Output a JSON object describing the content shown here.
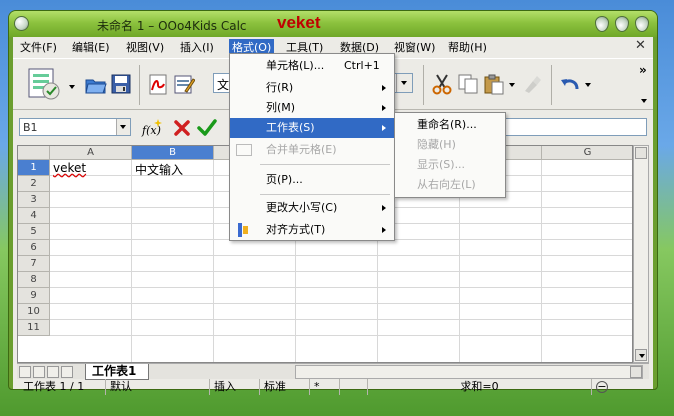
{
  "window": {
    "title": "未命名 1 – OOo4Kids Calc",
    "user": "veket"
  },
  "menubar": {
    "items": [
      "文件(F)",
      "编辑(E)",
      "视图(V)",
      "插入(I)",
      "格式(O)",
      "工具(T)",
      "数据(D)",
      "视窗(W)",
      "帮助(H)"
    ],
    "active": "格式(O)"
  },
  "toolbar": {
    "font_name": "文",
    "overflow": "»"
  },
  "formula": {
    "name_box": "B1",
    "function_icon": "f(x)"
  },
  "sheet": {
    "columns": [
      "A",
      "B",
      "C",
      "D",
      "E",
      "F",
      "G"
    ],
    "selected_column": "B",
    "rows": [
      "1",
      "2",
      "3",
      "4",
      "5",
      "6",
      "7",
      "8",
      "9",
      "10",
      "11"
    ],
    "cells": {
      "A1": "veket",
      "B1": "中文输入"
    },
    "tab": "工作表1"
  },
  "status": {
    "sheet_info": "工作表 1 / 1",
    "page_style": "默认",
    "insert_mode": "插入",
    "selection_mode": "标准",
    "modified": "*",
    "sum": "求和=0"
  },
  "format_menu": {
    "items": [
      {
        "label": "单元格(L)...",
        "shortcut": "Ctrl+1"
      },
      {
        "label": "行(R)"
      },
      {
        "label": "列(M)"
      },
      {
        "label": "工作表(S)"
      },
      {
        "label": "合并单元格(E)"
      },
      {
        "label": "页(P)..."
      },
      {
        "label": "更改大小写(C)"
      },
      {
        "label": "对齐方式(T)"
      }
    ]
  },
  "sheet_submenu": {
    "items": [
      "重命名(R)...",
      "隐藏(H)",
      "显示(S)...",
      "从右向左(L)"
    ]
  },
  "colors": {
    "menu_highlight": "#316ac5",
    "title_bar": "#8cc23e",
    "user_text": "#c00000"
  }
}
